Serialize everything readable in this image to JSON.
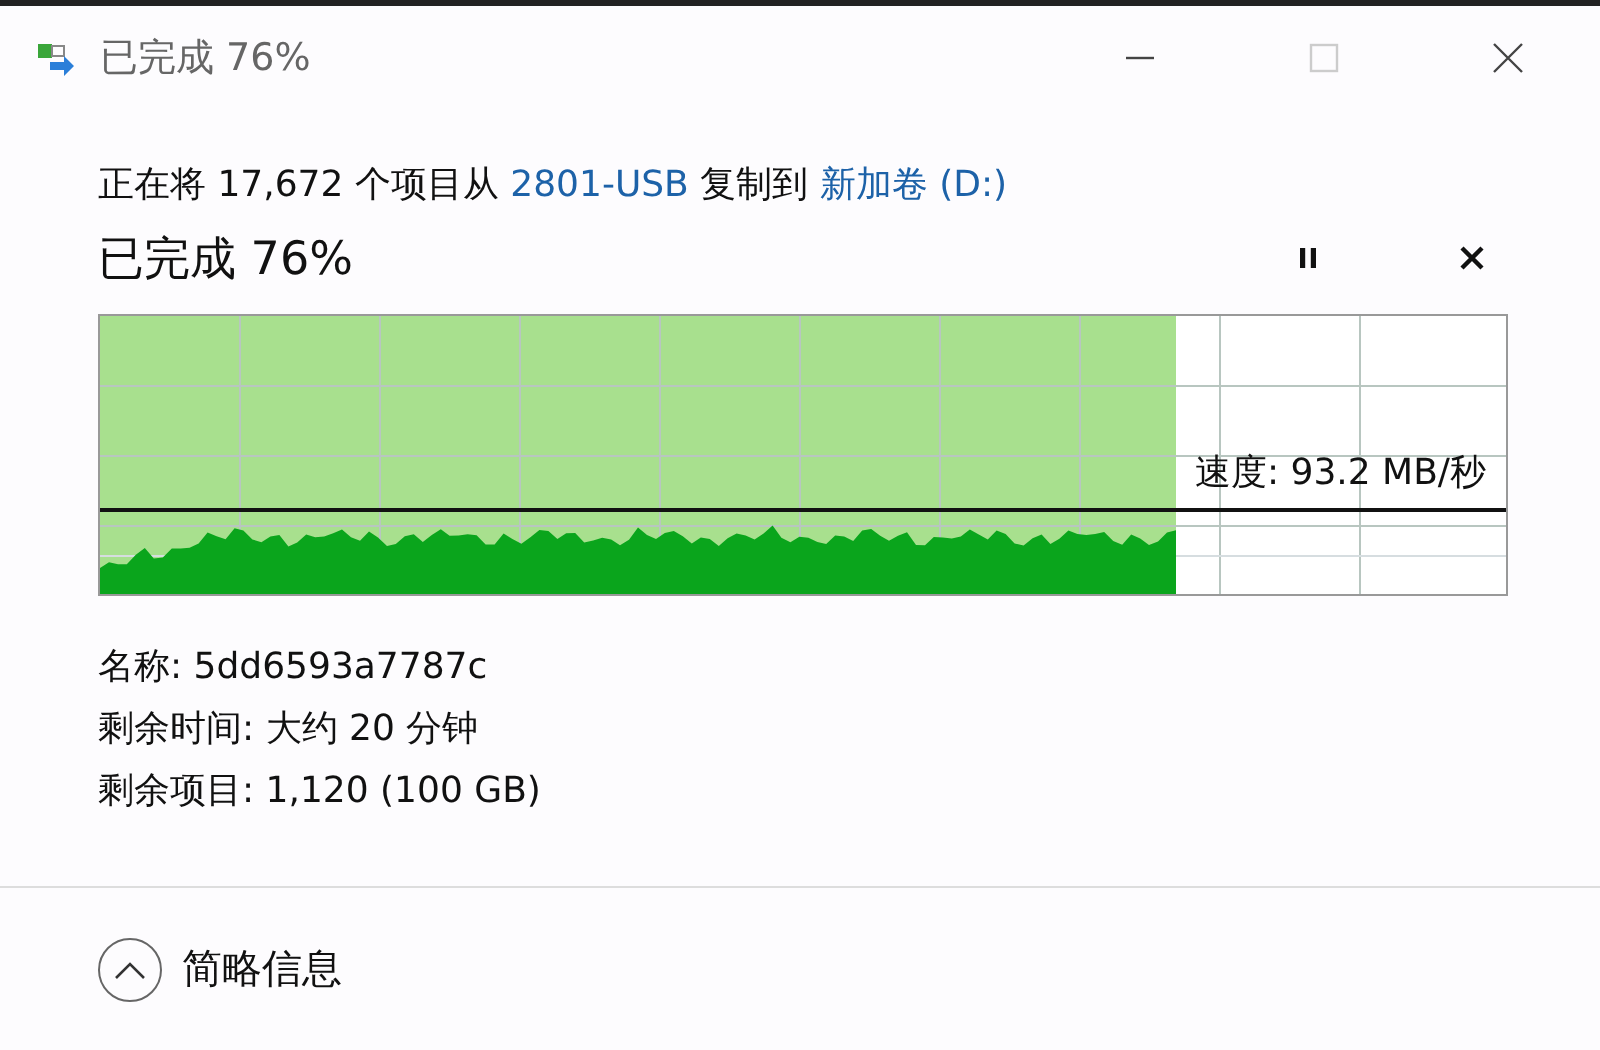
{
  "window": {
    "title": "已完成 76%",
    "controls": [
      {
        "kind": "minimize",
        "disabled": false
      },
      {
        "kind": "maximize",
        "disabled": true
      },
      {
        "kind": "close",
        "disabled": false
      }
    ]
  },
  "header": {
    "segments": [
      {
        "kind": "text",
        "text": "正在将 17,672 个项目从 "
      },
      {
        "kind": "link",
        "text": "2801-USB"
      },
      {
        "kind": "text",
        "text": " 复制到 "
      },
      {
        "kind": "link",
        "text": "新加卷 (D:)"
      }
    ]
  },
  "progress": {
    "title": "已完成 76%",
    "level": 0.765,
    "speed": "速度: 93.2 MB/秒",
    "actions": [
      {
        "kind": "pause"
      },
      {
        "kind": "cancel"
      }
    ]
  },
  "details": [
    {
      "label": "名称:",
      "value": "5dd6593a7787c"
    },
    {
      "label": "剩余时间:",
      "value": "大约 20 分钟"
    },
    {
      "label": "剩余项目:",
      "value": "1,120 (100 GB)"
    }
  ],
  "footer": {
    "label": "简略信息",
    "expanded": true
  }
}
